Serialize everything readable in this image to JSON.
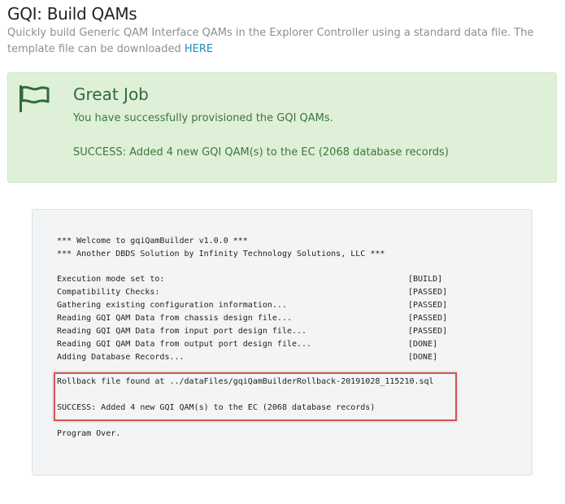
{
  "header": {
    "title": "GQI: Build QAMs",
    "subtitle_text": "Quickly build Generic QAM Interface QAMs in the Explorer Controller using a standard data file. The template file can be downloaded",
    "subtitle_link": "HERE"
  },
  "alert": {
    "icon": "flag-icon",
    "title": "Great Job",
    "message": "You have successfully provisioned the GQI QAMs.",
    "result": "SUCCESS: Added 4 new GQI QAM(s) to the EC (2068 database records)",
    "background": "#dff0d8",
    "text_color": "#3c763d"
  },
  "console": {
    "welcome": [
      "*** Welcome to gqiQamBuilder v1.0.0 ***",
      "*** Another DBDS Solution by Infinity Technology Solutions, LLC ***"
    ],
    "steps": [
      {
        "text": "Execution mode set to:",
        "status": "[BUILD]"
      },
      {
        "text": "Compatibility Checks:",
        "status": "[PASSED]"
      },
      {
        "text": "Gathering existing configuration information...",
        "status": "[PASSED]"
      },
      {
        "text": "Reading GQI QAM Data from chassis design file...",
        "status": "[PASSED]"
      },
      {
        "text": "Reading GQI QAM Data from input port design file...",
        "status": "[PASSED]"
      },
      {
        "text": "Reading GQI QAM Data from output port design file...",
        "status": "[DONE]"
      },
      {
        "text": "Adding Database Records...",
        "status": "[DONE]"
      }
    ],
    "rollback": "Rollback file found at ../dataFiles/gqiQamBuilderRollback-20191028_115210.sql",
    "success": "SUCCESS: Added 4 new GQI QAM(s) to the EC (2068 database records)",
    "end": "Program Over.",
    "highlight_color": "#d9534f"
  }
}
